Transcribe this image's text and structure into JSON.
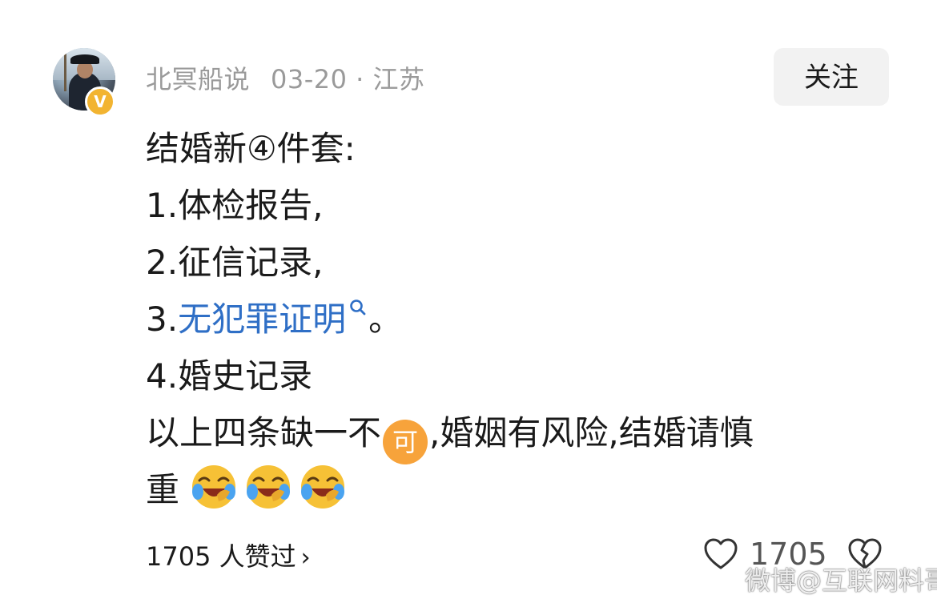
{
  "post_header": {
    "author": "北冥船说",
    "date": "03-20",
    "separator": "·",
    "location": "江苏",
    "verified_badge": "V",
    "follow_label": "关注"
  },
  "post_body": {
    "line1": "结婚新④件套:",
    "line2": "1.体检报告,",
    "line3": "2.征信记录,",
    "line4_prefix": "3.",
    "line4_link": "无犯罪证明",
    "line4_suffix": "。",
    "line5": "4.婚史记录",
    "line6_part1": "以上四条缺一不",
    "emoji_ke_text": "可",
    "line6_part2": ",婚姻有风险,结婚请慎",
    "line7": "重"
  },
  "footer": {
    "likes_text": "1705 人赞过",
    "chevron": "›",
    "like_count": "1705"
  },
  "watermark": "微博@互联网料哥",
  "icons": {
    "search": "search-icon",
    "heart": "heart-icon",
    "broken_heart": "broken-heart-icon",
    "laugh_cry": "laugh-cry-emoji"
  },
  "colors": {
    "link": "#2f6fc6",
    "badge": "#f2b431",
    "meta_text": "#9a9a9a",
    "follow_bg": "#f2f2f2"
  }
}
